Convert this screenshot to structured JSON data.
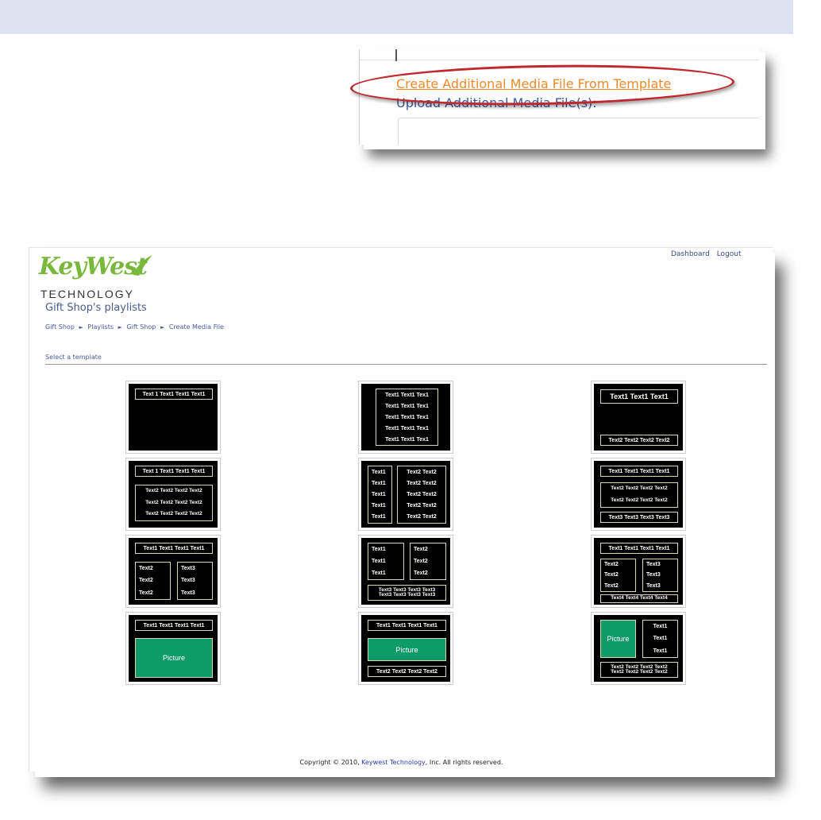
{
  "inset": {
    "link_create": "Create Additional Media File From Template",
    "link_upload": "Upload Additional Media File(s):"
  },
  "header": {
    "logo_word": "KeyWest",
    "logo_sub": "TECHNOLOGY",
    "links": [
      "Dashboard",
      "Logout"
    ]
  },
  "page": {
    "title": "Gift Shop's playlists",
    "breadcrumb": [
      "Gift Shop",
      "Playlists",
      "Gift Shop",
      "Create Media File"
    ],
    "breadcrumb_sep": "►",
    "select_label": "Select a template"
  },
  "templates": {
    "t1": {
      "r1": "Text 1 Text1 Text1 Text1"
    },
    "t2": {
      "lines": [
        "Text1 Text1 Tex1",
        "Text1 Text1 Tex1",
        "Text1 Text1 Tex1",
        "Text1 Text1 Tex1",
        "Text1 Text1 Tex1"
      ]
    },
    "t3": {
      "r1": "Text1 Text1 Text1",
      "r2": "Text2 Text2 Text2 Text2"
    },
    "t4": {
      "r1": "Text 1 Text1 Text1 Text1",
      "lines": [
        "Text2 Text2 Text2 Text2",
        "Text2 Text2 Text2 Text2",
        "Text2 Text2 Text2 Text2"
      ]
    },
    "t5": {
      "left": [
        "Text1",
        "Text1",
        "Text1",
        "Text1",
        "Text1"
      ],
      "right": [
        "Text2 Text2",
        "Text2 Text2",
        "Text2 Text2",
        "Text2 Text2",
        "Text2 Text2"
      ]
    },
    "t6": {
      "r1": "Text1 Text1 Text1 Text1",
      "lines": [
        "Text2 Text2 Text2 Text2",
        "Text2 Text2 Text2 Text2"
      ],
      "r3": "Text3 Text3 Text3 Text3"
    },
    "t7": {
      "r1": "Text1 Text1 Text1 Text1",
      "left": [
        "Text2",
        "Text2",
        "Text2"
      ],
      "right": [
        "Text3",
        "Text3",
        "Text3"
      ]
    },
    "t8": {
      "left": [
        "Text1",
        "Text1",
        "Text1"
      ],
      "right": [
        "Text2",
        "Text2",
        "Text2"
      ],
      "bottom": [
        "Text3 Text3 Text3 Text3",
        "Text3 Text3 Text3 Text3"
      ]
    },
    "t9": {
      "r1": "Text1 Text1 Text1 Text1",
      "left": [
        "Text2",
        "Text2",
        "Text2"
      ],
      "right": [
        "Text3",
        "Text3",
        "Text3"
      ],
      "r4": "Text4 Text4 Text4 Text4"
    },
    "t10": {
      "r1": "Text1 Text1 Text1 Text1",
      "pic": "Picture"
    },
    "t11": {
      "r1": "Text1 Text1 Text1 Text1",
      "pic": "Picture",
      "r3": "Text2 Text2 Text2 Text2"
    },
    "t12": {
      "pic": "Picture",
      "right": [
        "Text1",
        "Text1",
        "Text1"
      ],
      "bottom": [
        "Text2 Text2 Text2 Text2",
        "Text2 Text2 Text2 Text2"
      ]
    }
  },
  "footer": {
    "pre": "Copyright © 2010,",
    "link": "Keywest Technology",
    "post": ", Inc. All rights reserved."
  },
  "colors": {
    "accent_orange": "#f08a2a",
    "oval_red": "#c0282f",
    "picture_green": "#0f9a6a",
    "logo_green": "#79b83a"
  }
}
